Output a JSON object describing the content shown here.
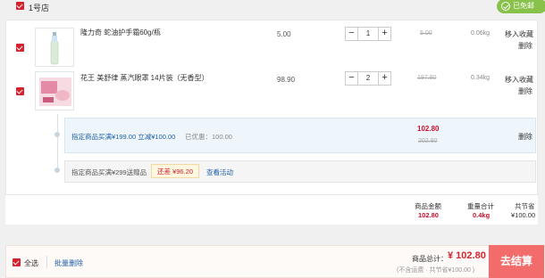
{
  "store": {
    "name": "1号店",
    "free_shipping_badge": "已免邮"
  },
  "items": [
    {
      "name": "隆力奇 蛇油护手霜60g/瓶",
      "price": "5.00",
      "quantity": "1",
      "original_price": "5.00",
      "weight": "0.06kg",
      "move_to_favorites": "移入收藏",
      "delete": "删除"
    },
    {
      "name": "花王 美舒律 蒸汽眼罩 14片装（无香型）",
      "price": "98.90",
      "quantity": "2",
      "original_price": "197.80",
      "weight": "0.34kg",
      "move_to_favorites": "移入收藏",
      "delete": "删除"
    }
  ],
  "stepper": {
    "minus": "−",
    "plus": "+"
  },
  "promo_full_reduction": {
    "label": "指定商品买满¥199.00 立减¥100.00",
    "saved": "已优惠：100.00",
    "price_after": "102.80",
    "price_before": "202.80",
    "delete": "删除"
  },
  "promo_gift": {
    "label": "指定商品买满¥299送赠品",
    "still_short": "还差 ¥96.20",
    "view_activity": "查看活动"
  },
  "summary": {
    "amount_label": "商品金额",
    "amount_value": "102.80",
    "weight_label": "重量合计",
    "weight_value": "0.4kg",
    "saved_label": "共节省",
    "saved_value": "¥100.00"
  },
  "bottom_bar": {
    "select_all": "全选",
    "batch_delete": "批量删除",
    "total_label": "商品总计：",
    "total_value": "¥ 102.80",
    "total_note": "(不含运费 · 共节省¥100.00 )",
    "checkout": "去结算"
  },
  "colors": {
    "accent_red": "#d4232f",
    "free_ship_green": "#88c24a",
    "checkout_bg": "#f36c6c",
    "link_blue": "#1f5fa8"
  }
}
